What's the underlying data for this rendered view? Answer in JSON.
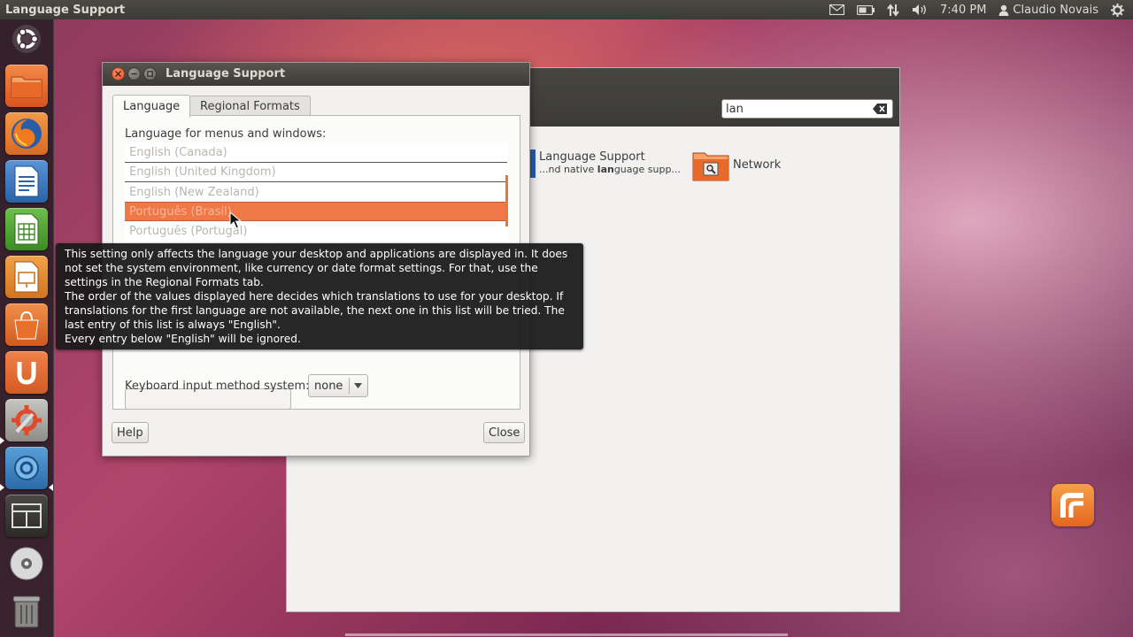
{
  "top_panel": {
    "window_title": "Language Support",
    "clock": "7:40 PM",
    "user": "Claudio Novais"
  },
  "launcher": {
    "items": [
      "dash-home",
      "files",
      "firefox",
      "writer",
      "calc",
      "impress",
      "software-center",
      "ubuntu-one",
      "system-settings",
      "remmina",
      "workspaces",
      "disc",
      "trash"
    ]
  },
  "settings_window": {
    "search_value": "lan",
    "results": [
      {
        "title": "Language Support",
        "subtitle_pre": "...nd native ",
        "subtitle_bold": "lan",
        "subtitle_post": "guage supp..."
      },
      {
        "title": "Network"
      }
    ]
  },
  "dialog": {
    "title": "Language Support",
    "tabs": [
      "Language",
      "Regional Formats"
    ],
    "list_label": "Language for menus and windows:",
    "languages": [
      "English (Canada)",
      "English (United Kingdom)",
      "English (New Zealand)",
      "Português (Brasil)",
      "Português (Portugal)"
    ],
    "selected_language": "Português (Brasil)",
    "keyboard_label": "Keyboard input method system:",
    "keyboard_value": "none",
    "help_label": "Help",
    "close_label": "Close"
  },
  "tooltip": {
    "lines": [
      "This setting only affects the language your desktop and applications are displayed in. It does",
      "not set the system environment, like currency or date format settings. For that, use the",
      "settings in the Regional Formats tab.",
      "The order of the values displayed here decides which translations to use for your desktop. If",
      "translations for the first language are not available, the next one in this list will be tried. The",
      "last entry of this list is always \"English\".",
      "Every entry below \"English\" will be ignored."
    ]
  },
  "colors": {
    "panel": "#3c3b37",
    "selection": "#f07746",
    "close_button": "#e3572a",
    "dialog_bg": "#f2f1f0"
  }
}
